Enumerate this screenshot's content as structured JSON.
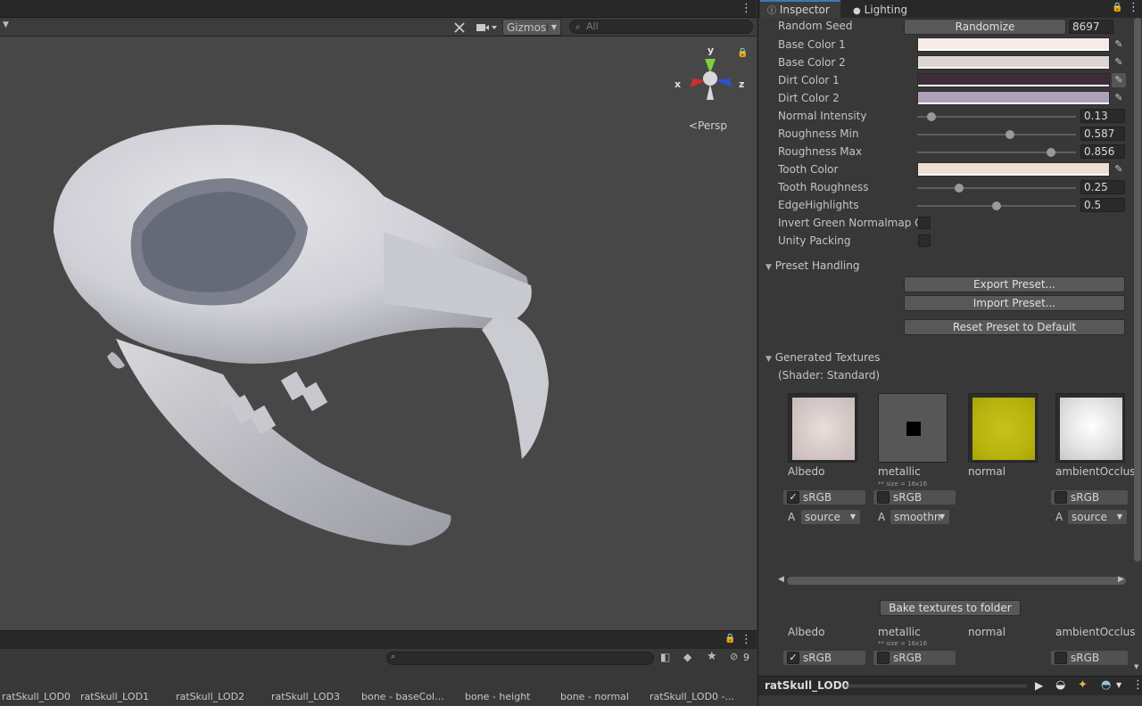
{
  "scene": {
    "toolbar": {
      "gizmos_label": "Gizmos",
      "search_placeholder": "All"
    },
    "persp_label": "<Persp",
    "axis_labels": {
      "x": "x",
      "y": "y",
      "z": "z"
    }
  },
  "bottom": {
    "visible_count": "9",
    "assets": [
      "ratSkull_LOD0",
      "ratSkull_LOD1",
      "ratSkull_LOD2",
      "ratSkull_LOD3",
      "bone - baseCol...",
      "bone - height",
      "bone - normal",
      "ratSkull_LOD0 -..."
    ]
  },
  "inspector": {
    "tabs": {
      "inspector": "Inspector",
      "lighting": "Lighting"
    },
    "random_seed": {
      "label": "Random Seed",
      "button": "Randomize",
      "value": "8697"
    },
    "colors": [
      {
        "label": "Base Color 1",
        "color": "#f6ebe6"
      },
      {
        "label": "Base Color 2",
        "color": "#ddd5d2"
      },
      {
        "label": "Dirt Color 1",
        "color": "#3f2c3b"
      },
      {
        "label": "Dirt Color 2",
        "color": "#aea0b9"
      }
    ],
    "sliders": [
      {
        "label": "Normal Intensity",
        "value": "0.13",
        "fraction": 0.09
      },
      {
        "label": "Roughness Min",
        "value": "0.587",
        "fraction": 0.585
      },
      {
        "label": "Roughness Max",
        "value": "0.856",
        "fraction": 0.855
      }
    ],
    "tooth_color": {
      "label": "Tooth Color",
      "color": "#ecdfd0"
    },
    "sliders2": [
      {
        "label": "Tooth Roughness",
        "value": "0.25",
        "fraction": 0.26
      },
      {
        "label": "EdgeHighlights",
        "value": "0.5",
        "fraction": 0.5
      }
    ],
    "toggles": [
      {
        "label": "Invert Green Normalmap Ch",
        "checked": false
      },
      {
        "label": "Unity Packing",
        "checked": false
      }
    ],
    "preset": {
      "header": "Preset Handling",
      "export": "Export Preset...",
      "import": "Import Preset...",
      "reset": "Reset Preset to Default"
    },
    "generated": {
      "header": "Generated Textures",
      "shader": "(Shader: Standard)",
      "size_note": "** size = 16x16",
      "textures": [
        {
          "label": "Albedo",
          "srgb": "sRGB",
          "srgb_checked": true,
          "alpha": "source",
          "alpha_label": "A"
        },
        {
          "label": "metallic",
          "srgb": "sRGB",
          "srgb_checked": false,
          "alpha": "smoothn",
          "alpha_label": "A"
        },
        {
          "label": "normal"
        },
        {
          "label": "ambientOcclus",
          "srgb": "sRGB",
          "srgb_checked": false,
          "alpha": "source",
          "alpha_label": "A"
        }
      ],
      "bake_button": "Bake textures to folder"
    },
    "preview": {
      "object_name": "ratSkull_LOD0"
    }
  }
}
